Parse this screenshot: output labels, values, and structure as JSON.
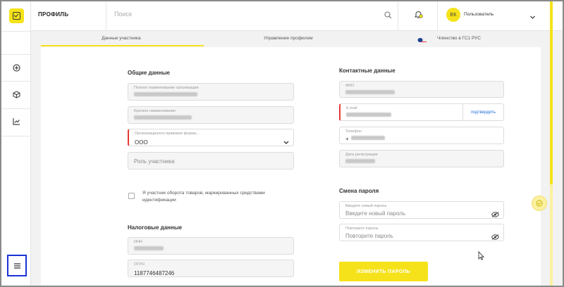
{
  "header": {
    "title": "ПРОФИЛЬ",
    "search_placeholder": "Поиск",
    "user_initials": "ЕК",
    "user_name": "Пользователь"
  },
  "tabs": [
    {
      "label": "Данные участника",
      "active": true
    },
    {
      "label": "Управление профилем",
      "active": false
    },
    {
      "label": "Членство в ГС1 РУС",
      "active": false
    }
  ],
  "general": {
    "title": "Общие данные",
    "full_name_label": "Полное наименование организации",
    "short_name_label": "Краткое наименование",
    "legal_form_label": "Организационно-правовая форма...",
    "legal_form_value": "ООО",
    "role_placeholder": "Роль участника",
    "checkbox_label": "Я участник оборота товаров, маркированных средствами идентификации"
  },
  "tax": {
    "title": "Налоговые данные",
    "inn_label": "ИНН",
    "ogrn_label": "ОГРН",
    "ogrn_value": "1187746487246"
  },
  "contacts": {
    "title": "Контактные данные",
    "fio_label": "ФИО",
    "email_label": "E-mail",
    "confirm_label": "подтвердить",
    "phone_label": "Телефон",
    "phone_prefix": "+",
    "reg_date_label": "Дата регистрации"
  },
  "password": {
    "title": "Смена пароля",
    "new_label": "Введите новый пароль",
    "new_placeholder": "Введите новый пароль",
    "repeat_label": "Повторите пароль",
    "repeat_placeholder": "Повторите пароль",
    "button_label": "ИЗМЕНИТЬ ПАРОЛЬ"
  },
  "colors": {
    "accent": "#f5e21a",
    "error": "#e53935",
    "link": "#1e6fd9",
    "highlight": "#1a33d6"
  }
}
